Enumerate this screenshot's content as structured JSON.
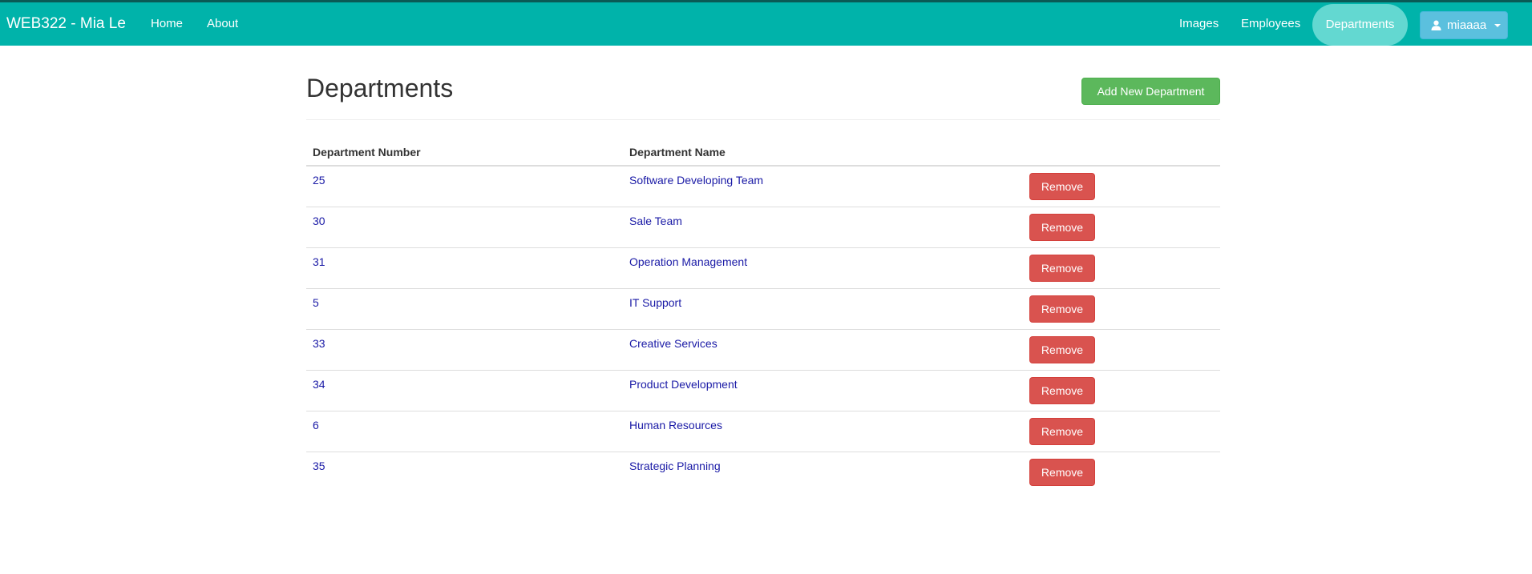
{
  "navbar": {
    "brand": "WEB322 - Mia Le",
    "left_links": [
      "Home",
      "About"
    ],
    "right_links": [
      "Images",
      "Employees"
    ],
    "active_link": "Departments",
    "user": {
      "icon": "user-icon",
      "name": "miaaaa"
    }
  },
  "page": {
    "title": "Departments",
    "add_button": "Add New Department"
  },
  "table": {
    "headers": [
      "Department Number",
      "Department Name"
    ],
    "remove_label": "Remove",
    "rows": [
      {
        "number": "25",
        "name": "Software Developing Team"
      },
      {
        "number": "30",
        "name": "Sale Team"
      },
      {
        "number": "31",
        "name": "Operation Management"
      },
      {
        "number": "5",
        "name": "IT Support"
      },
      {
        "number": "33",
        "name": "Creative Services"
      },
      {
        "number": "34",
        "name": "Product Development"
      },
      {
        "number": "6",
        "name": "Human Resources"
      },
      {
        "number": "35",
        "name": "Strategic Planning"
      }
    ]
  },
  "colors": {
    "navbar": "#00b3aa",
    "navbar_active": "#63d8d1",
    "user_button": "#5bc0de",
    "add_button": "#5cb85c",
    "remove_button": "#d9534f",
    "link": "#1a1aa6"
  }
}
